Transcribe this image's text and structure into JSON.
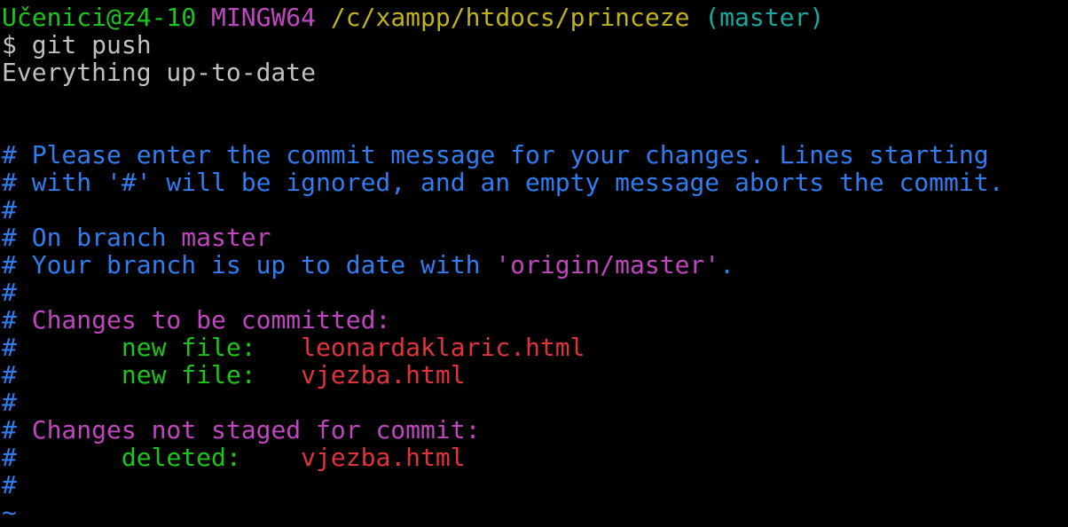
{
  "prompt": {
    "user_host": "Učenici@z4-10",
    "system": "MINGW64",
    "path": "/c/xampp/htdocs/princeze",
    "branch": "(master)"
  },
  "command": "$ git push",
  "output": "Everything up-to-date",
  "editor": {
    "line1": "# Please enter the commit message for your changes. Lines starting",
    "line2": "# with '#' will be ignored, and an empty message aborts the commit.",
    "hash": "#",
    "on_branch_prefix": "# On branch ",
    "on_branch_name": "master",
    "your_branch_prefix": "# Your branch is up to date with ",
    "your_branch_remote": "'origin/master'",
    "your_branch_suffix": ".",
    "changes_staged_header": "Changes to be committed:",
    "staged": [
      {
        "status": "new file:",
        "file": "leonardaklaric.html"
      },
      {
        "status": "new file:",
        "file": "vjezba.html"
      }
    ],
    "changes_unstaged_header": "Changes not staged for commit:",
    "unstaged": [
      {
        "status": "deleted:",
        "file": "vjezba.html"
      }
    ],
    "tilde": "~"
  }
}
